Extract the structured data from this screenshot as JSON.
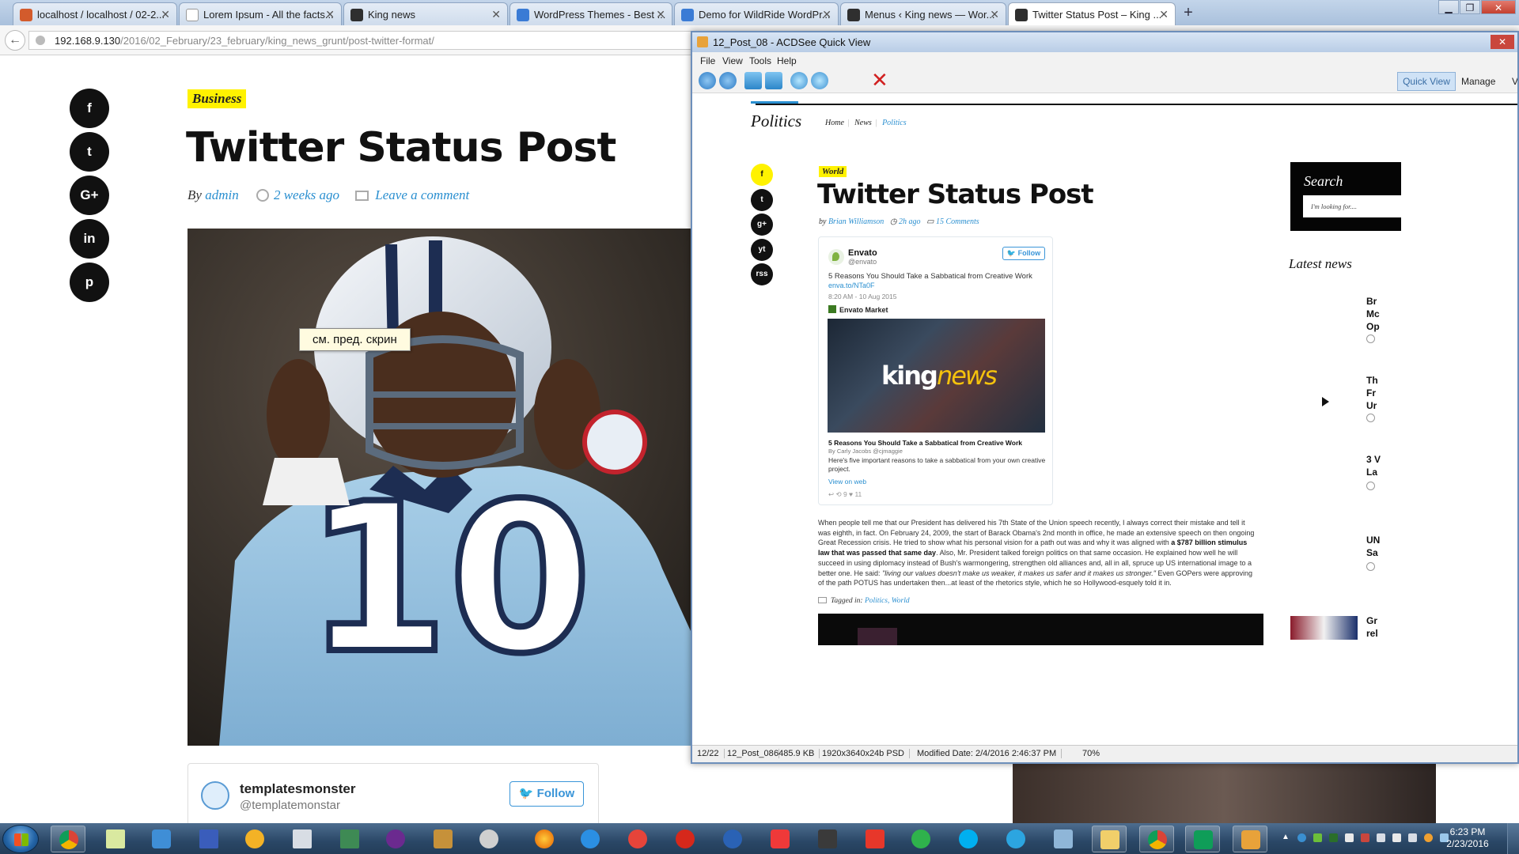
{
  "browser": {
    "tabs": [
      {
        "label": "localhost / localhost / 02-2...",
        "fav": "#d35b2c"
      },
      {
        "label": "Lorem Ipsum - All the facts...",
        "fav": "#ffffff"
      },
      {
        "label": "King news",
        "fav": "#2f2f2f"
      },
      {
        "label": "WordPress Themes - Best ...",
        "fav": "#3a7bd5"
      },
      {
        "label": "Demo for WildRide WordPr...",
        "fav": "#3a7bd5"
      },
      {
        "label": "Menus ‹ King news — Wor...",
        "fav": "#2f2f2f"
      },
      {
        "label": "Twitter Status Post – King ...",
        "fav": "#2f2f2f"
      }
    ],
    "url_host": "192.168.9.130",
    "url_path": "/2016/02_February/23_february/king_news_grunt/post-twitter-format/"
  },
  "left_page": {
    "social": [
      "f",
      "t",
      "G+",
      "in",
      "p"
    ],
    "category": "Business",
    "title": "Twitter Status Post",
    "meta_by": "By",
    "meta_author": "admin",
    "meta_time": "2 weeks ago",
    "meta_comment": "Leave a comment",
    "tooltip": "см. пред. скрин",
    "tweet_name": "templatesmonster",
    "tweet_handle": "@templatemonstar",
    "tweet_follow": "Follow"
  },
  "acdsee": {
    "title": "12_Post_08 - ACDSee Quick View",
    "menu": [
      "File",
      "View",
      "Tools",
      "Help"
    ],
    "mode_quick": "Quick View",
    "mode_manage": "Manage",
    "mode_view": "Vi",
    "status": [
      "12/22",
      "12_Post_08",
      "6485.9 KB",
      "1920x3640x24b PSD",
      "Modified Date: 2/4/2016 2:46:37 PM",
      "70%"
    ]
  },
  "viewer": {
    "section": "Politics",
    "crumbs": [
      "Home",
      "News",
      "Politics"
    ],
    "social": [
      "f",
      "t",
      "g+",
      "yt",
      "rss"
    ],
    "category": "World",
    "title": "Twitter Status Post",
    "meta_by": "by",
    "meta_author": "Brian Williamson",
    "meta_time": "2h ago",
    "meta_comments": "15 Comments",
    "tweet": {
      "name": "Envato",
      "handle": "@envato",
      "follow": "Follow",
      "text": "5 Reasons You Should Take a Sabbatical from Creative Work",
      "link": "enva.to/NTa0F",
      "date": "8:20 AM - 10 Aug 2015",
      "market": "Envato Market",
      "brand_a": "king",
      "brand_b": "news",
      "headline": "5 Reasons You Should Take a Sabbatical from Creative Work",
      "byline": "By Carly Jacobs @cjmaggie",
      "desc": "Here's five important reasons to take a sabbatical from your own creative project.",
      "view": "View on web",
      "actions": "↩     ⟲ 9     ♥ 11"
    },
    "body_a": "When people tell me that our President has delivered his 7th State of the Union speech recently, I always correct their mistake and tell it was eighth, in fact. On February 24, 2009, the start of Barack Obama's 2nd month in office, he made an extensive speech on then ongoing Great Recession crisis. He tried to show what his personal vision for a path out was and why it was aligned with ",
    "body_bold": "a $787 billion stimulus law that was passed that same day",
    "body_b": ". Also, Mr. President talked foreign politics on that same occasion. He explained how well he will succeed in using diplomacy instead of Bush's warmongering, strengthen old alliances and, all in all, spruce up US international image to a better one. He said: ",
    "body_quote": "\"living our values doesn't make us weaker, it makes us safer and it makes us stronger.\"",
    "body_c": " Even GOPers were approving of the path POTUS has undertaken then...at least of the rhetorics style, which he so Hollywood-esquely told it in.",
    "tagged_label": "Tagged in:",
    "tags": "Politics, World",
    "search_title": "Search",
    "search_placeholder": "I'm looking for....",
    "latest_title": "Latest news",
    "latest": [
      {
        "t1": "Br",
        "t2": "Mc",
        "t3": "Op"
      },
      {
        "t1": "Th",
        "t2": "Fr",
        "t3": "Ur"
      },
      {
        "t1": "3 V",
        "t2": "La",
        "t3": ""
      },
      {
        "t1": "UN",
        "t2": "Sa",
        "t3": ""
      },
      {
        "t1": "Gr",
        "t2": "rel",
        "t3": ""
      }
    ]
  },
  "taskbar": {
    "time": "6:23 PM",
    "date": "2/23/2016"
  }
}
